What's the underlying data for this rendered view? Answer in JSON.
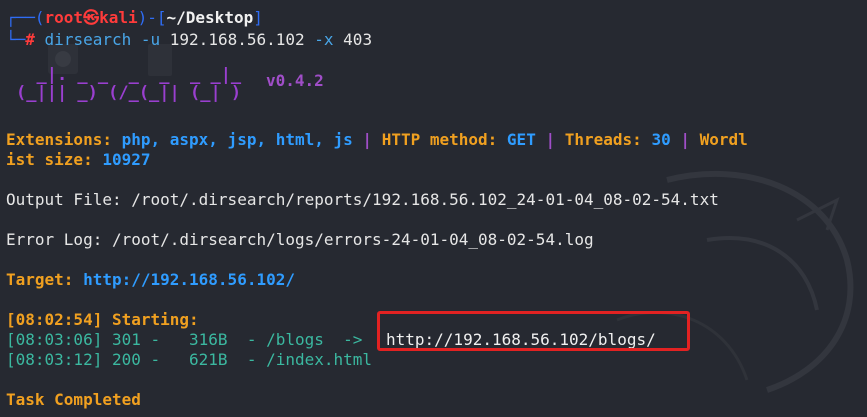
{
  "prompt": {
    "frame_top": "┌──(",
    "user": "root",
    "at_icon": "㉿",
    "host": "kali",
    "sep": ")-[",
    "cwd": "~/Desktop",
    "end": "]",
    "frame_bottom": "└─",
    "hash": "#",
    "command": "dirsearch",
    "args": [
      " -u ",
      "192.168.56.102",
      " -x ",
      "403"
    ]
  },
  "banner": {
    "logo_line1": "  _|. _ _  _  _  _ _|_",
    "logo_line2": "(_||| _) (/_(_|| (_| )",
    "version": "v0.4.2"
  },
  "config": {
    "extensions_label": "Extensions: ",
    "extensions_value": "php, aspx, jsp, html, js",
    "pipe1": " | ",
    "method_label": "HTTP method: ",
    "method_value": "GET",
    "pipe2": " | ",
    "threads_label": "Threads: ",
    "threads_value": "30",
    "pipe3": " | ",
    "wordlist_label_a": "Wordl",
    "wordlist_label_b": "ist size: ",
    "wordlist_value": "10927"
  },
  "output_file": "Output File: /root/.dirsearch/reports/192.168.56.102_24-01-04_08-02-54.txt",
  "error_log": "Error Log: /root/.dirsearch/logs/errors-24-01-04_08-02-54.log",
  "target": {
    "label": "Target: ",
    "url": "http://192.168.56.102/"
  },
  "start": {
    "time": "[08:02:54]",
    "text": " Starting:"
  },
  "results": [
    {
      "line": "[08:03:06] 301 -   316B  - /blogs  ->",
      "redirect": "http://192.168.56.102/blogs/"
    },
    {
      "line": "[08:03:12] 200 -   621B  - /index.html"
    }
  ],
  "done": "Task Completed",
  "colors": {
    "background": "#262931",
    "prompt_frame": "#2f6df6",
    "root_red": "#ff3b3b",
    "orange": "#f0a020",
    "blue": "#2f9cff",
    "purple": "#a04ec8",
    "result_green": "#3bb8a0",
    "highlight_red": "#e22222"
  }
}
